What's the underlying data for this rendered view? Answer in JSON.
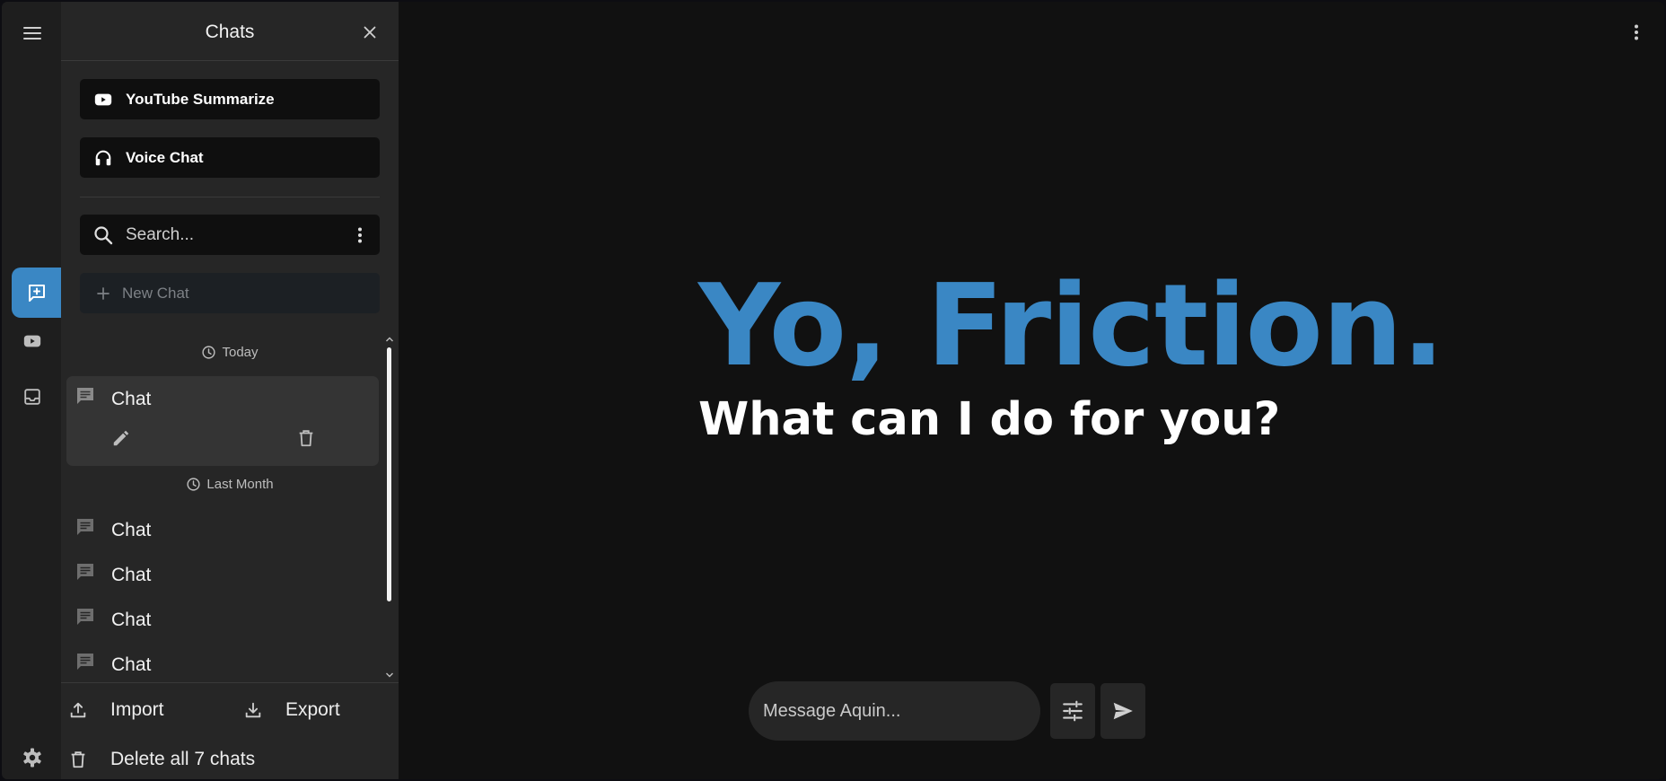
{
  "drawer": {
    "title": "Chats",
    "quick_actions": [
      {
        "label": "YouTube Summarize",
        "icon": "youtube-icon"
      },
      {
        "label": "Voice Chat",
        "icon": "headset-icon"
      }
    ],
    "search": {
      "placeholder": "Search..."
    },
    "new_chat_label": "New Chat",
    "groups": [
      {
        "label": "Today",
        "chats": [
          {
            "title": "Chat",
            "selected": true
          }
        ]
      },
      {
        "label": "Last Month",
        "chats": [
          {
            "title": "Chat"
          },
          {
            "title": "Chat"
          },
          {
            "title": "Chat"
          },
          {
            "title": "Chat"
          }
        ]
      }
    ],
    "import_label": "Import",
    "export_label": "Export",
    "delete_all_label": "Delete all 7 chats"
  },
  "rail": {
    "items": [
      "hamburger-menu-icon",
      "new-chat-icon",
      "youtube-icon",
      "inbox-icon",
      "settings-gear-icon"
    ],
    "active_index": 1
  },
  "main": {
    "greeting": "Yo, Friction.",
    "subtitle": "What can I do for you?",
    "composer_placeholder": "Message Aquin..."
  },
  "colors": {
    "accent": "#3a87c4",
    "background": "#111111",
    "drawer": "#262626",
    "rail": "#1e1e1e"
  }
}
